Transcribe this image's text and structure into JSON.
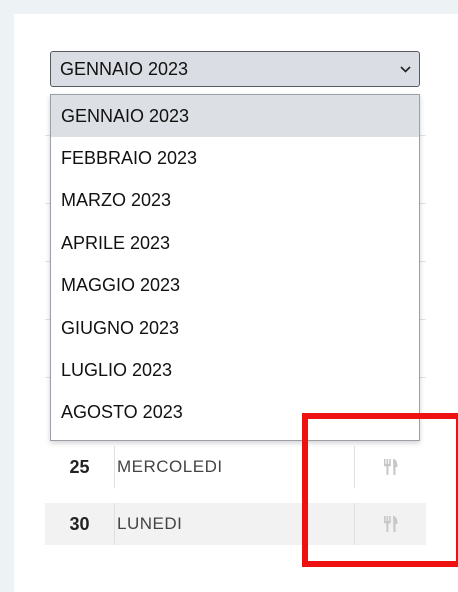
{
  "month_select": {
    "selected_label": "GENNAIO 2023",
    "options": [
      "GENNAIO 2023",
      "FEBBRAIO 2023",
      "MARZO 2023",
      "APRILE 2023",
      "MAGGIO 2023",
      "GIUGNO 2023",
      "LUGLIO 2023",
      "AGOSTO 2023"
    ],
    "highlighted_index": 0
  },
  "calendar": {
    "rows": [
      {
        "day": "25",
        "weekday": "MERCOLEDI",
        "icon": "fork-knife-icon"
      },
      {
        "day": "30",
        "weekday": "LUNEDI",
        "icon": "fork-knife-icon"
      }
    ]
  },
  "colors": {
    "page_background": "#edf2f5",
    "selected_option": "#dcdfe4",
    "highlight_box": "#ee1111",
    "icon": "#c7c7c7"
  }
}
